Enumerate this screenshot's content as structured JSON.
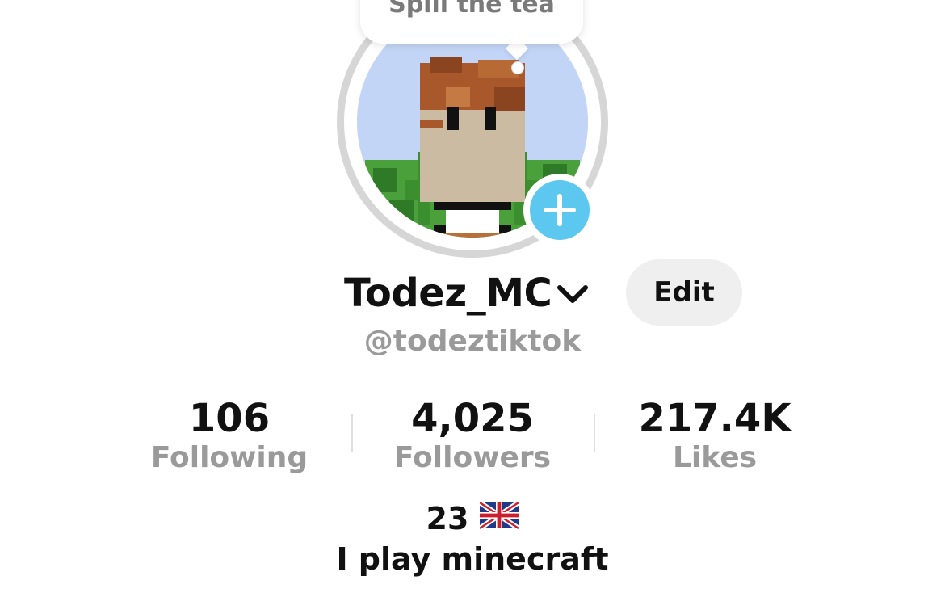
{
  "bubble": {
    "text": "Spill the tea"
  },
  "profile": {
    "display_name": "Todez_MC",
    "username": "@todeztiktok",
    "edit_label": "Edit"
  },
  "stats": {
    "following": {
      "value": "106",
      "label": "Following"
    },
    "followers": {
      "value": "4,025",
      "label": "Followers"
    },
    "likes": {
      "value": "217.4K",
      "label": "Likes"
    }
  },
  "bio": {
    "age": "23",
    "flag_icon": "uk-flag-icon",
    "text": "I play minecraft"
  },
  "icons": {
    "add": "plus-icon",
    "dropdown": "chevron-down-icon"
  },
  "colors": {
    "add_button": "#5cc8f0",
    "ring": "#d6d6d6",
    "secondary_text": "#9a9a9a"
  }
}
